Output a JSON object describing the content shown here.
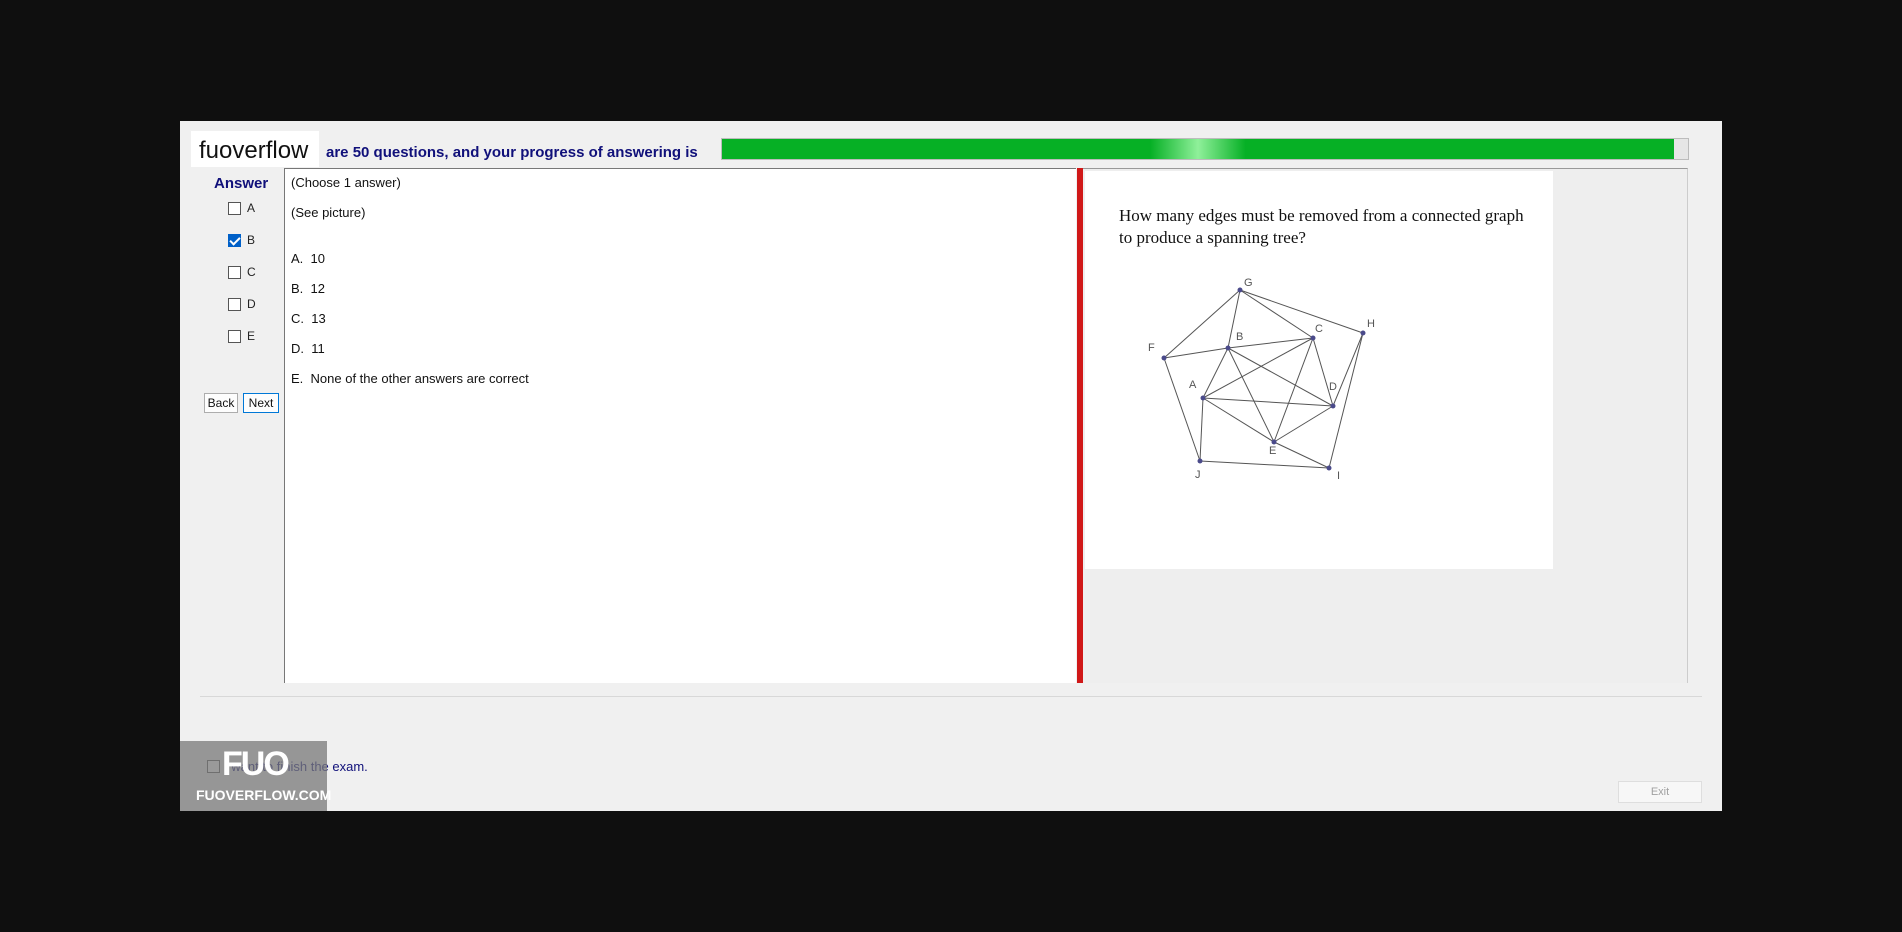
{
  "header": {
    "logo": "fuoverflow",
    "progress_text": "are 50 questions, and your progress of answering is",
    "progress_fraction": 0.985,
    "progress_color": "#06b025"
  },
  "answer_panel": {
    "title": "Answer",
    "options": [
      {
        "label": "A",
        "checked": false
      },
      {
        "label": "B",
        "checked": true
      },
      {
        "label": "C",
        "checked": false
      },
      {
        "label": "D",
        "checked": false
      },
      {
        "label": "E",
        "checked": false
      }
    ],
    "back_label": "Back",
    "next_label": "Next"
  },
  "question": {
    "instruction": "(Choose 1 answer)",
    "note": "(See picture)",
    "choices": [
      {
        "letter": "A.",
        "text": "10"
      },
      {
        "letter": "B.",
        "text": "12"
      },
      {
        "letter": "C.",
        "text": "13"
      },
      {
        "letter": "D.",
        "text": "11"
      },
      {
        "letter": "E.",
        "text": "None of the other answers are correct"
      }
    ]
  },
  "picture": {
    "question_text": "How many edges must be removed from a connected graph to produce a spanning tree?",
    "vertices": [
      "A",
      "B",
      "C",
      "D",
      "E",
      "F",
      "G",
      "H",
      "I",
      "J"
    ],
    "edges": [
      [
        "F",
        "G"
      ],
      [
        "G",
        "C"
      ],
      [
        "G",
        "H"
      ],
      [
        "G",
        "B"
      ],
      [
        "F",
        "B"
      ],
      [
        "F",
        "J"
      ],
      [
        "B",
        "C"
      ],
      [
        "B",
        "A"
      ],
      [
        "B",
        "E"
      ],
      [
        "B",
        "D"
      ],
      [
        "C",
        "A"
      ],
      [
        "C",
        "E"
      ],
      [
        "C",
        "D"
      ],
      [
        "H",
        "D"
      ],
      [
        "H",
        "I"
      ],
      [
        "A",
        "D"
      ],
      [
        "A",
        "E"
      ],
      [
        "A",
        "J"
      ],
      [
        "E",
        "D"
      ],
      [
        "E",
        "I"
      ],
      [
        "J",
        "I"
      ]
    ]
  },
  "footer": {
    "finish_label": "I want to finish the exam.",
    "exit_label": "Exit"
  },
  "watermark": {
    "logo": "FUO",
    "url": "FUOVERFLOW.COM"
  }
}
